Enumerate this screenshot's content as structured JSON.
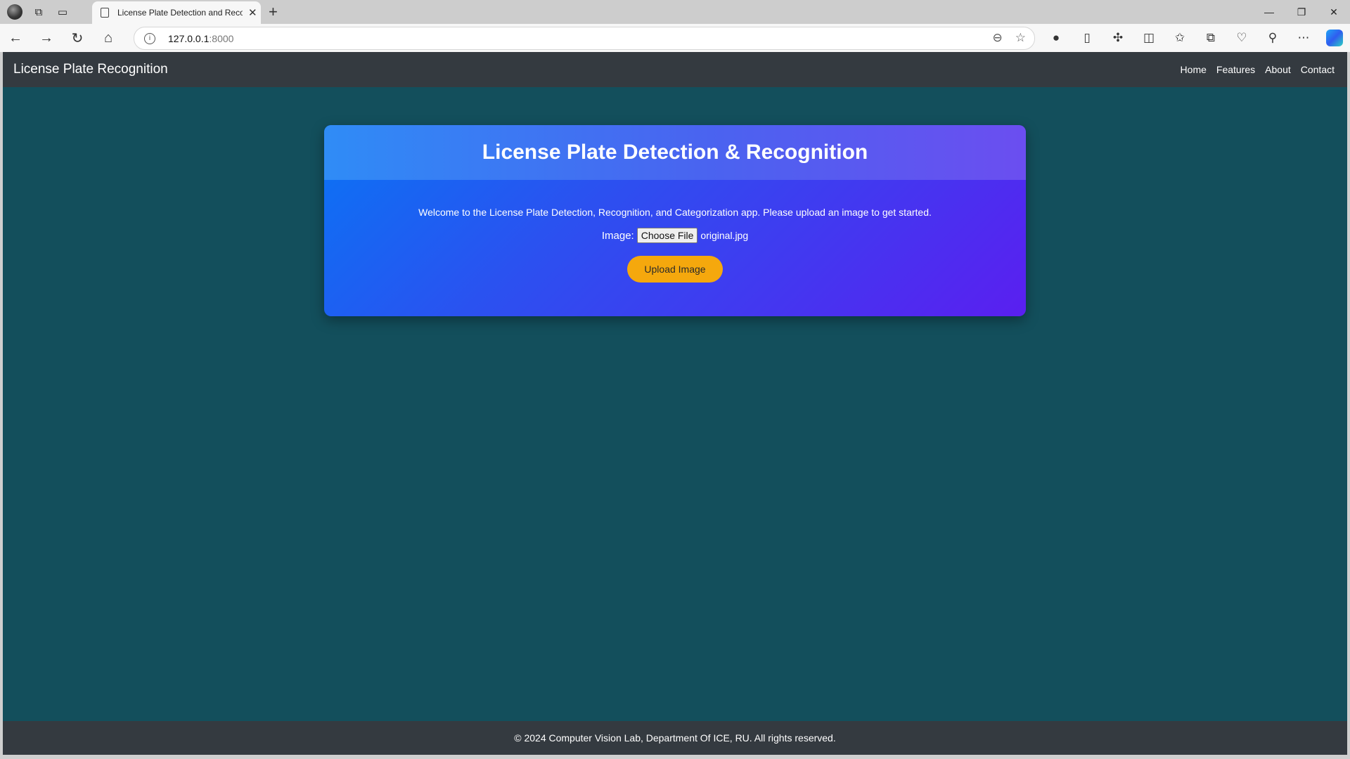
{
  "browser": {
    "tab_title": "License Plate Detection and Recognition",
    "tab_close": "✕",
    "new_tab": "+",
    "url_host": "127.0.0.1",
    "url_port": ":8000",
    "window_controls": {
      "minimize": "—",
      "restore": "❐",
      "close": "✕"
    }
  },
  "navbar": {
    "brand": "License Plate Recognition",
    "links": [
      "Home",
      "Features",
      "About",
      "Contact"
    ]
  },
  "card": {
    "title": "License Plate Detection & Recognition",
    "welcome": "Welcome to the License Plate Detection, Recognition, and Categorization app. Please upload an image to get started.",
    "image_label": "Image:",
    "choose_file_label": "Choose File",
    "file_name": "original.jpg",
    "upload_label": "Upload Image"
  },
  "footer": {
    "text": "© 2024 Computer Vision Lab, Department Of ICE, RU. All rights reserved."
  },
  "colors": {
    "page_bg": "#134f5c",
    "navbar_bg": "#343a40",
    "card_gradient_start": "#0a74f4",
    "card_gradient_end": "#5a1ff0",
    "upload_button": "#f5a80d"
  }
}
